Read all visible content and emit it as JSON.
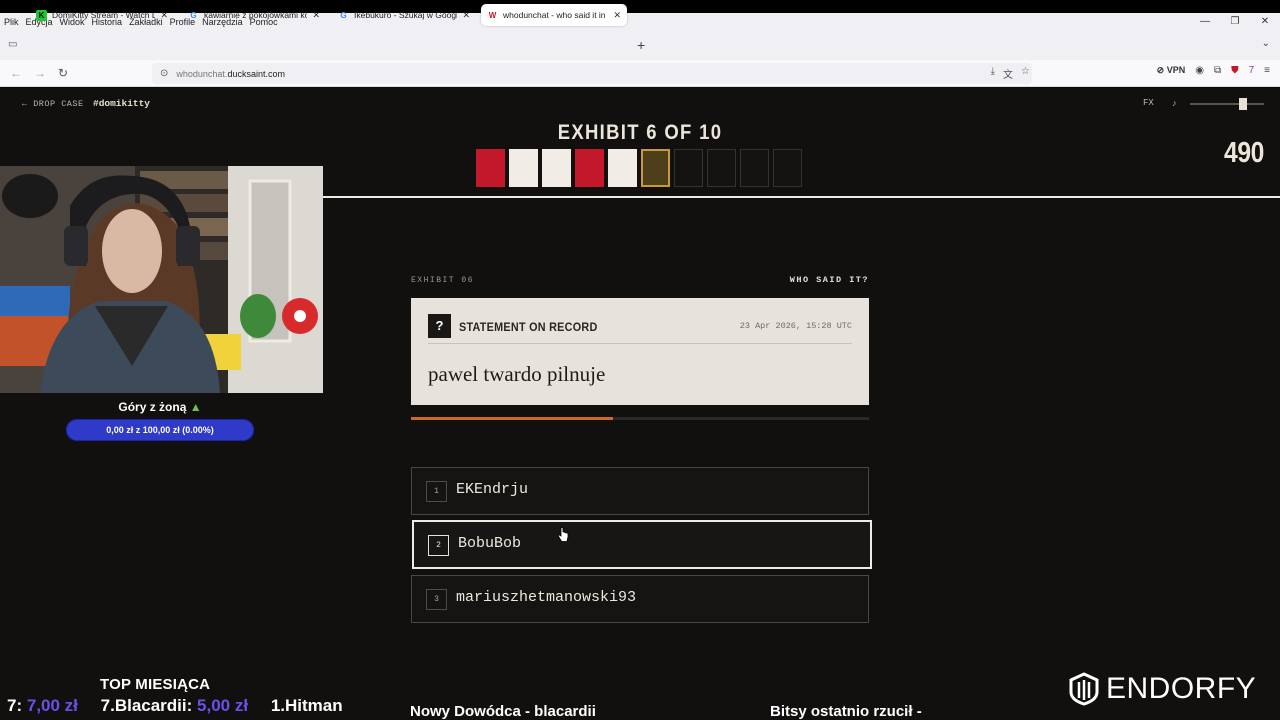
{
  "browser": {
    "menu": [
      "Plik",
      "Edycja",
      "Widok",
      "Historia",
      "Zakładki",
      "Profile",
      "Narzędzia",
      "Pomoc"
    ],
    "tabs": [
      {
        "title": "DomiKitty Stream - Watch Live",
        "icon": "kick-icon",
        "color": "#1cc92b"
      },
      {
        "title": "kawiarnie z pokojówkami korea",
        "icon": "google-icon",
        "color": "#4285f4"
      },
      {
        "title": "Ikebukuro - Szukaj w Google",
        "icon": "google-icon",
        "color": "#4285f4"
      },
      {
        "title": "whodunchat - who said it in yo",
        "icon": "whodunchat-icon",
        "color": "#c3182b"
      }
    ],
    "url_prefix": "whodunchat.",
    "url_domain": "ducksaint.com",
    "vpn_label": "VPN"
  },
  "game": {
    "drop_case": "← DROP CASE",
    "channel": "#domikitty",
    "fx": "FX",
    "note_icon": "♪",
    "volume": 0.75,
    "score": "490",
    "exhibit_title": "EXHIBIT 6 OF 10",
    "progress": [
      "wrong",
      "right",
      "right",
      "wrong",
      "right",
      "current",
      "pending",
      "pending",
      "pending",
      "pending"
    ],
    "exhibit_label": "EXHIBIT 06",
    "who_said": "WHO SAID IT?",
    "statement_icon": "?",
    "statement_title": "STATEMENT ON RECORD",
    "statement_date": "23 Apr 2026, 15:28 UTC",
    "quote": "pawel twardo pilnuje",
    "timer_fraction": 0.44,
    "options": [
      {
        "num": "1",
        "name": "EKEndrju"
      },
      {
        "num": "2",
        "name": "BobuBob"
      },
      {
        "num": "3",
        "name": "mariuszhetmanowski93"
      }
    ],
    "hovered_option": 2,
    "colors": {
      "wrong": "#c3182b",
      "right": "#f1ede6",
      "current": "#c99b35",
      "accent": "#cf6a25"
    }
  },
  "stream": {
    "goal_title": "Góry z żoną",
    "goal_icon": "mountain-icon",
    "goal_progress": "0,00 zł z 100,00 zł (0.00%)",
    "top_label": "TOP MIESIĄCA",
    "ticker": [
      {
        "name": "7:",
        "amount": "7,00 zł"
      },
      {
        "name": "7.Blacardii:",
        "amount": "5,00 zł"
      },
      {
        "name": "1.Hitman",
        "amount": ""
      }
    ],
    "new_commander": "Nowy Dowódca - blacardii",
    "bits": "Bitsy ostatnio rzucił -",
    "sponsor": "ENDORFY"
  }
}
